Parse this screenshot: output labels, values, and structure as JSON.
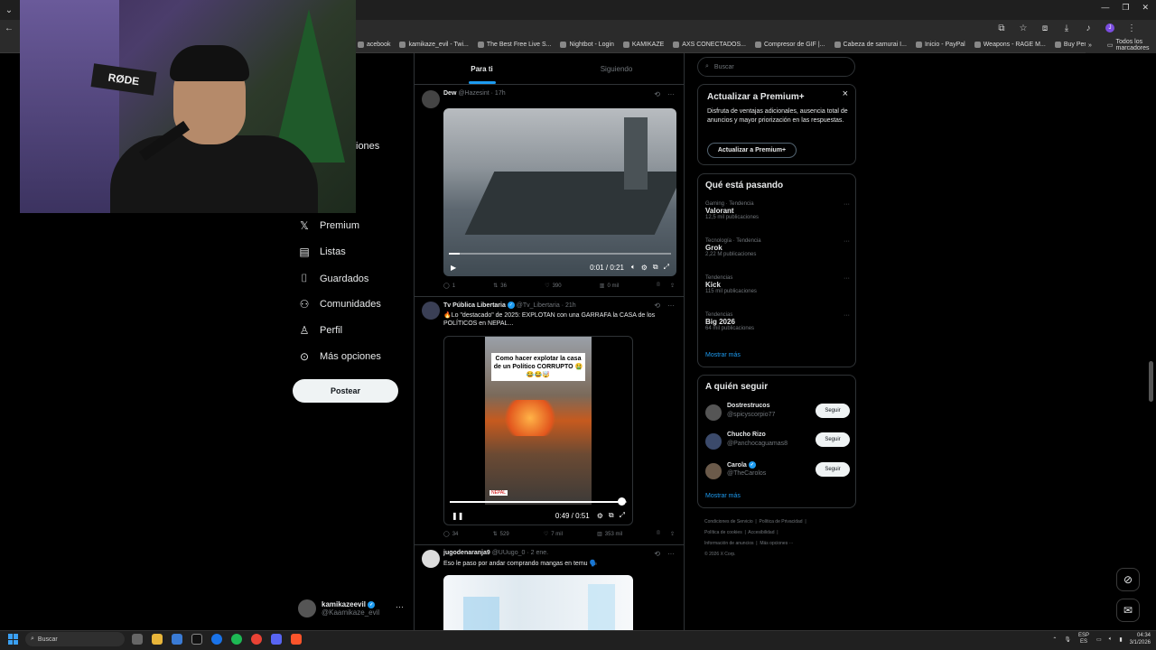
{
  "browser": {
    "bookmarks": [
      "acebook",
      "kamikaze_evil - Twi...",
      "The Best Free Live S...",
      "Nightbot - Login",
      "KAMIKAZE",
      "AXS CONECTADOS...",
      "Compresor de GIF |...",
      "Cabeza de samurai I...",
      "Inicio - PayPal",
      "Weapons - RAGE M...",
      "Buy Personalized 11..."
    ],
    "bookmarks_more": "»",
    "all_bookmarks": "Todos los marcadores",
    "profile_initial": "J"
  },
  "webcam": {
    "mic_label": "RØDE"
  },
  "nav": {
    "partial_item": "iones",
    "items": [
      {
        "label": "Premium",
        "icon": "x-logo-icon"
      },
      {
        "label": "Listas",
        "icon": "list-icon"
      },
      {
        "label": "Guardados",
        "icon": "bookmark-icon"
      },
      {
        "label": "Comunidades",
        "icon": "communities-icon"
      },
      {
        "label": "Perfil",
        "icon": "profile-icon"
      },
      {
        "label": "Más opciones",
        "icon": "more-icon"
      }
    ],
    "post_button": "Postear",
    "account": {
      "name": "kamikazeevil",
      "handle": "@Kaamikaze_evil",
      "more": "···"
    }
  },
  "feed": {
    "tabs": [
      "Para ti",
      "Siguiendo"
    ],
    "tweets": [
      {
        "name": "Dew",
        "handle": "@Hazesint",
        "time": "· 17h",
        "video": {
          "time": "0:01 / 0:21",
          "progress": 0.05
        },
        "actions": {
          "replies": "1",
          "reposts": "36",
          "likes": "390",
          "views": "0 mil"
        }
      },
      {
        "name": "Tv Pública Libertaria",
        "handle": "@Tv_Libertaria",
        "time": "· 21h",
        "text": "🔥Lo \"destacado\" de 2025: EXPLOTAN con una GARRAFA la CASA de los POLÍTICOS en NEPAL...",
        "video": {
          "caption": "Como hacer explotar la casa de un Político CORRUPTO 🤮",
          "emojis": "😂😂🤯",
          "badge": "NEPAL",
          "time": "0:49 / 0:51",
          "progress": 0.96
        },
        "actions": {
          "replies": "34",
          "reposts": "529",
          "likes": "7 mil",
          "views": "353 mil"
        }
      },
      {
        "name": "jugodenaranja9",
        "handle": "@UUugo_0",
        "time": "· 2 ene.",
        "text": "Eso le paso por andar comprando mangas en temu 🗣️"
      }
    ]
  },
  "right": {
    "search_placeholder": "Buscar",
    "premium": {
      "title": "Actualizar a Premium+",
      "body": "Disfruta de ventajas adicionales, ausencia total de anuncios y mayor priorización en las respuestas.",
      "button": "Actualizar a Premium+",
      "close": "×"
    },
    "trending": {
      "title": "Qué está pasando",
      "items": [
        {
          "category": "Gaming · Tendencia",
          "name": "Valorant",
          "count": "12,5 mil publicaciones"
        },
        {
          "category": "Tecnología · Tendencia",
          "name": "Grok",
          "count": "2,22 M publicaciones"
        },
        {
          "category": "Tendencias",
          "name": "Kick",
          "count": "115 mil publicaciones"
        },
        {
          "category": "Tendencias",
          "name": "Big 2026",
          "count": "64 mil publicaciones"
        }
      ],
      "show_more": "Mostrar más"
    },
    "who_to_follow": {
      "title": "A quién seguir",
      "items": [
        {
          "name": "Dostrestrucos",
          "handle": "@spicyscorpio77",
          "button": "Seguir"
        },
        {
          "name": "Chucho Rizo",
          "handle": "@Panchocaguamas8",
          "button": "Seguir"
        },
        {
          "name": "Carola",
          "handle": "@TheCarolos",
          "button": "Seguir"
        }
      ],
      "show_more": "Mostrar más"
    },
    "footer": [
      "Condiciones de Servicio",
      "Política de Privacidad",
      "Política de cookies",
      "Accesibilidad",
      "Información de anuncios",
      "Más opciones ···",
      "© 2026 X Corp."
    ]
  },
  "taskbar": {
    "search": "Buscar",
    "lang": "ESP",
    "lang_sub": "ES",
    "time": "04:34",
    "date": "3/1/2026"
  }
}
